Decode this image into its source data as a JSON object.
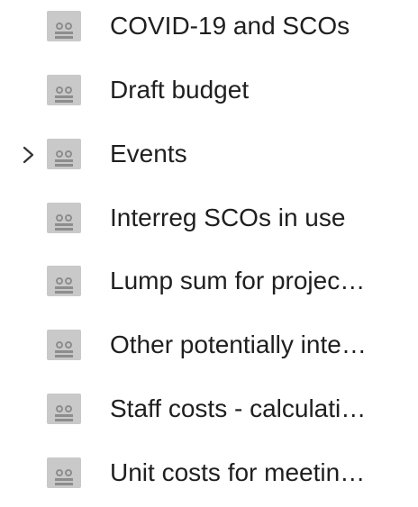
{
  "tree": {
    "items": [
      {
        "label": "COVID-19 and SCOs",
        "icon": "group-folder-icon",
        "expandable": false
      },
      {
        "label": "Draft budget",
        "icon": "group-folder-icon",
        "expandable": false
      },
      {
        "label": "Events",
        "icon": "group-folder-icon",
        "expandable": true,
        "expanded": false
      },
      {
        "label": "Interreg SCOs in use",
        "icon": "group-folder-icon",
        "expandable": false
      },
      {
        "label": "Lump sum for projec…",
        "icon": "group-folder-icon",
        "expandable": false
      },
      {
        "label": "Other potentially inte…",
        "icon": "group-folder-icon",
        "expandable": false
      },
      {
        "label": "Staff costs - calculati…",
        "icon": "group-folder-icon",
        "expandable": false
      },
      {
        "label": "Unit costs for meetin…",
        "icon": "group-folder-icon",
        "expandable": false
      }
    ]
  },
  "colors": {
    "icon_background": "#c9c9c9",
    "icon_people": "#8d8d8d",
    "text": "#1f1f1f",
    "chevron": "#333333"
  }
}
